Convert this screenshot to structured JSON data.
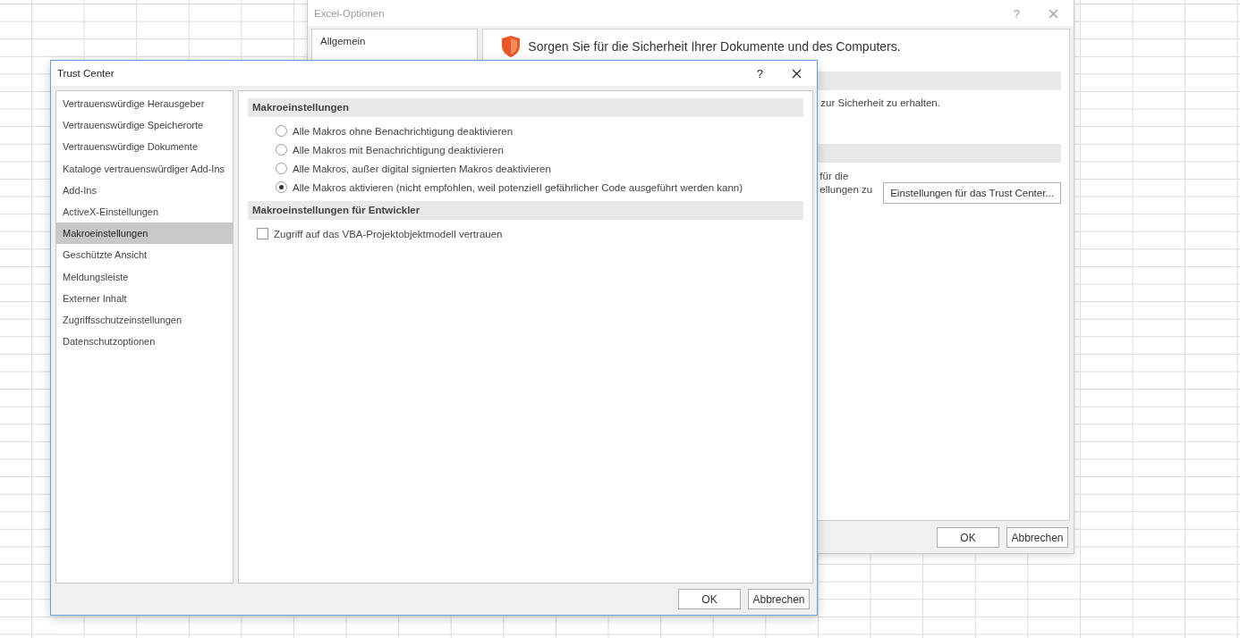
{
  "background_window": {
    "title": "Excel-Optionen",
    "help": "?",
    "sidebar_items": [
      "Allgemein"
    ],
    "heading": "Sorgen Sie für die Sicherheit Ihrer Dokumente und des Computers.",
    "section_1_text": "zur Sicherheit zu erhalten.",
    "section_2_lines": [
      "für die",
      "ellungen zu"
    ],
    "trust_center_button": "Einstellungen für das Trust Center...",
    "buttons": [
      "OK",
      "Abbrechen"
    ]
  },
  "dialog": {
    "title": "Trust Center",
    "help": "?",
    "sidebar_items": [
      {
        "label": "Vertrauenswürdige Herausgeber",
        "selected": false
      },
      {
        "label": "Vertrauenswürdige Speicherorte",
        "selected": false
      },
      {
        "label": "Vertrauenswürdige Dokumente",
        "selected": false
      },
      {
        "label": "Kataloge vertrauenswürdiger Add-Ins",
        "selected": false
      },
      {
        "label": "Add-Ins",
        "selected": false
      },
      {
        "label": "ActiveX-Einstellungen",
        "selected": false
      },
      {
        "label": "Makroeinstellungen",
        "selected": true
      },
      {
        "label": "Geschützte Ansicht",
        "selected": false
      },
      {
        "label": "Meldungsleiste",
        "selected": false
      },
      {
        "label": "Externer Inhalt",
        "selected": false
      },
      {
        "label": "Zugriffsschutzeinstellungen",
        "selected": false
      },
      {
        "label": "Datenschutzoptionen",
        "selected": false
      }
    ],
    "macro_section": {
      "heading": "Makroeinstellungen",
      "options": [
        {
          "label": "Alle Makros ohne Benachrichtigung deaktivieren",
          "selected": false
        },
        {
          "label": "Alle Makros mit Benachrichtigung deaktivieren",
          "selected": false
        },
        {
          "label": "Alle Makros, außer digital signierten Makros deaktivieren",
          "selected": false
        },
        {
          "label": "Alle Makros aktivieren (nicht empfohlen, weil potenziell gefährlicher Code ausgeführt werden kann)",
          "selected": true
        }
      ]
    },
    "developer_section": {
      "heading": "Makroeinstellungen für Entwickler",
      "checkbox": {
        "label": "Zugriff auf das VBA-Projektobjektmodell vertrauen",
        "checked": false
      }
    },
    "buttons": [
      "OK",
      "Abbrechen"
    ]
  }
}
